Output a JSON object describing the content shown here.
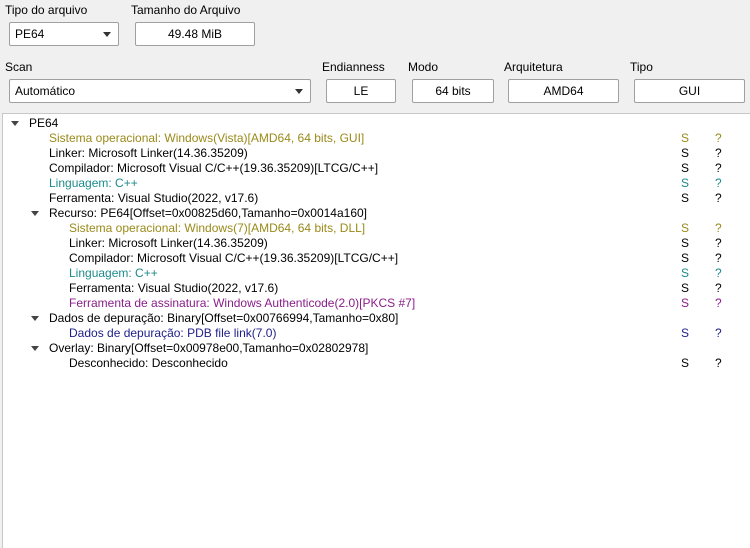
{
  "file_type": {
    "label": "Tipo do arquivo",
    "value": "PE64"
  },
  "file_size": {
    "label": "Tamanho do Arquivo",
    "value": "49.48 MiB"
  },
  "scan": {
    "label": "Scan",
    "value": "Automático"
  },
  "endianness": {
    "label": "Endianness",
    "value": "LE"
  },
  "mode": {
    "label": "Modo",
    "value": "64 bits"
  },
  "architecture": {
    "label": "Arquitetura",
    "value": "AMD64"
  },
  "type": {
    "label": "Tipo",
    "value": "GUI"
  },
  "colors": {
    "os": "#9a8a1a",
    "language": "#1e8a8a",
    "signtool": "#8a1e8a",
    "debug": "#1e1e8a",
    "normal": "#000000"
  },
  "tree": [
    {
      "text": "PE64",
      "s": "",
      "q": "",
      "color": "normal",
      "expanded": true
    },
    {
      "text": "Sistema operacional: Windows(Vista)[AMD64, 64 bits, GUI]",
      "s": "S",
      "q": "?",
      "color": "os"
    },
    {
      "text": "Linker: Microsoft Linker(14.36.35209)",
      "s": "S",
      "q": "?",
      "color": "normal"
    },
    {
      "text": "Compilador: Microsoft Visual C/C++(19.36.35209)[LTCG/C++]",
      "s": "S",
      "q": "?",
      "color": "normal"
    },
    {
      "text": "Linguagem: C++",
      "s": "S",
      "q": "?",
      "color": "language"
    },
    {
      "text": "Ferramenta: Visual Studio(2022, v17.6)",
      "s": "S",
      "q": "?",
      "color": "normal"
    },
    {
      "text": "Recurso: PE64[Offset=0x00825d60,Tamanho=0x0014a160]",
      "s": "",
      "q": "",
      "color": "normal",
      "expanded": true
    },
    {
      "text": "Sistema operacional: Windows(7)[AMD64, 64 bits, DLL]",
      "s": "S",
      "q": "?",
      "color": "os"
    },
    {
      "text": "Linker: Microsoft Linker(14.36.35209)",
      "s": "S",
      "q": "?",
      "color": "normal"
    },
    {
      "text": "Compilador: Microsoft Visual C/C++(19.36.35209)[LTCG/C++]",
      "s": "S",
      "q": "?",
      "color": "normal"
    },
    {
      "text": "Linguagem: C++",
      "s": "S",
      "q": "?",
      "color": "language"
    },
    {
      "text": "Ferramenta: Visual Studio(2022, v17.6)",
      "s": "S",
      "q": "?",
      "color": "normal"
    },
    {
      "text": "Ferramenta de assinatura: Windows Authenticode(2.0)[PKCS #7]",
      "s": "S",
      "q": "?",
      "color": "signtool"
    },
    {
      "text": "Dados de depuração: Binary[Offset=0x00766994,Tamanho=0x80]",
      "s": "",
      "q": "",
      "color": "normal",
      "expanded": true
    },
    {
      "text": "Dados de depuração: PDB file link(7.0)",
      "s": "S",
      "q": "?",
      "color": "debug"
    },
    {
      "text": "Overlay: Binary[Offset=0x00978e00,Tamanho=0x02802978]",
      "s": "",
      "q": "",
      "color": "normal",
      "expanded": true
    },
    {
      "text": "Desconhecido: Desconhecido",
      "s": "S",
      "q": "?",
      "color": "normal"
    }
  ]
}
